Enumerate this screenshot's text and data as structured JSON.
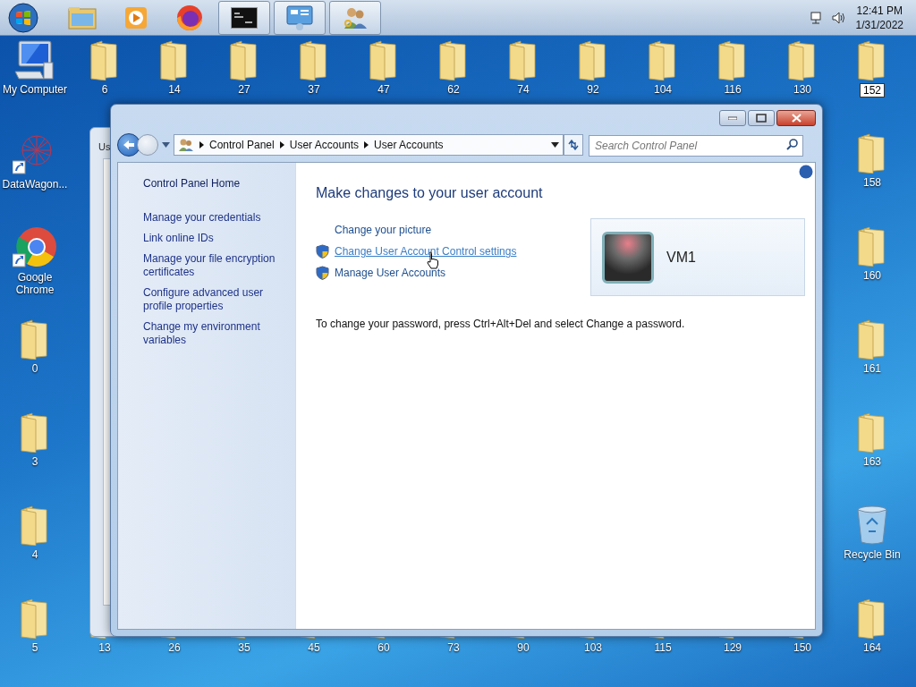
{
  "taskbar": {
    "items": [
      {
        "kind": "start",
        "active": false
      },
      {
        "kind": "explorer",
        "active": false
      },
      {
        "kind": "media",
        "active": false
      },
      {
        "kind": "firefox",
        "active": false
      },
      {
        "kind": "cmd",
        "active": true
      },
      {
        "kind": "control-panel",
        "active": true
      },
      {
        "kind": "users",
        "active": true
      }
    ],
    "time": "12:41 PM",
    "date": "1/31/2022"
  },
  "desktop": {
    "left_column": [
      {
        "label": "My Computer",
        "kind": "computer",
        "selected": false
      },
      {
        "label": "DataWagon...",
        "kind": "datawagon",
        "selected": false
      },
      {
        "label": "Google Chrome",
        "kind": "chrome",
        "selected": false
      },
      {
        "label": "0",
        "kind": "folder",
        "selected": false
      },
      {
        "label": "3",
        "kind": "folder",
        "selected": false
      },
      {
        "label": "4",
        "kind": "folder",
        "selected": false
      },
      {
        "label": "5",
        "kind": "folder",
        "selected": false
      }
    ],
    "top_row": [
      {
        "label": "6",
        "kind": "folder",
        "selected": false
      },
      {
        "label": "14",
        "kind": "folder",
        "selected": false
      },
      {
        "label": "27",
        "kind": "folder",
        "selected": false
      },
      {
        "label": "37",
        "kind": "folder",
        "selected": false
      },
      {
        "label": "47",
        "kind": "folder",
        "selected": false
      },
      {
        "label": "62",
        "kind": "folder",
        "selected": false
      },
      {
        "label": "74",
        "kind": "folder",
        "selected": false
      },
      {
        "label": "92",
        "kind": "folder",
        "selected": false
      },
      {
        "label": "104",
        "kind": "folder",
        "selected": false
      },
      {
        "label": "116",
        "kind": "folder",
        "selected": false
      },
      {
        "label": "130",
        "kind": "folder",
        "selected": false
      }
    ],
    "right_column": [
      {
        "label": "152",
        "kind": "folder",
        "selected": true
      },
      {
        "label": "158",
        "kind": "folder",
        "selected": false
      },
      {
        "label": "160",
        "kind": "folder",
        "selected": false
      },
      {
        "label": "161",
        "kind": "folder",
        "selected": false
      },
      {
        "label": "163",
        "kind": "folder",
        "selected": false
      },
      {
        "label": "Recycle Bin",
        "kind": "recycle",
        "selected": false
      },
      {
        "label": "164",
        "kind": "folder",
        "selected": false
      }
    ],
    "bottom_row": [
      {
        "label": "13",
        "kind": "folder",
        "selected": false
      },
      {
        "label": "26",
        "kind": "folder",
        "selected": false
      },
      {
        "label": "35",
        "kind": "folder",
        "selected": false
      },
      {
        "label": "45",
        "kind": "folder",
        "selected": false
      },
      {
        "label": "60",
        "kind": "folder",
        "selected": false
      },
      {
        "label": "73",
        "kind": "folder",
        "selected": false
      },
      {
        "label": "90",
        "kind": "folder",
        "selected": false
      },
      {
        "label": "103",
        "kind": "folder",
        "selected": false
      },
      {
        "label": "115",
        "kind": "folder",
        "selected": false
      },
      {
        "label": "129",
        "kind": "folder",
        "selected": false
      },
      {
        "label": "150",
        "kind": "folder",
        "selected": false
      }
    ]
  },
  "background_window": {
    "title": "Us"
  },
  "window": {
    "breadcrumb": [
      "Control Panel",
      "User Accounts",
      "User Accounts"
    ],
    "search": {
      "placeholder": "Search Control Panel"
    },
    "sidebar": {
      "home": "Control Panel Home",
      "links": [
        "Manage your credentials",
        "Link online IDs",
        "Manage your file encryption certificates",
        "Configure advanced user profile properties",
        "Change my environment variables"
      ]
    },
    "heading": "Make changes to your user account",
    "tasks": [
      {
        "label": "Change your picture",
        "shield": false,
        "hovered": false
      },
      {
        "label": "Change User Account Control settings",
        "shield": true,
        "hovered": true
      },
      {
        "label": "Manage User Accounts",
        "shield": true,
        "hovered": false
      }
    ],
    "account": {
      "name": "VM1"
    },
    "note": "To change your password, press Ctrl+Alt+Del and select Change a password."
  }
}
